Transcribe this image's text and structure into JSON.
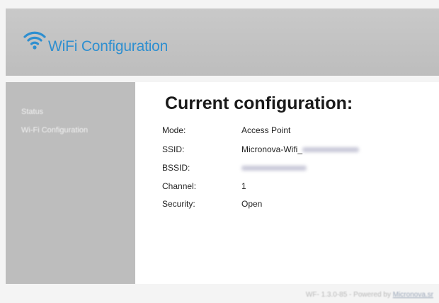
{
  "header": {
    "title": "WiFi Configuration",
    "logo_icon": "wifi-icon",
    "accent_color": "#2e8fd0"
  },
  "sidebar": {
    "items": [
      {
        "label": "Status"
      },
      {
        "label": "Wi-Fi Configuration"
      }
    ]
  },
  "main": {
    "title": "Current configuration:",
    "fields": [
      {
        "label": "Mode:",
        "value": "Access Point"
      },
      {
        "label": "SSID:",
        "value": "Micronova-Wifi_"
      },
      {
        "label": "BSSID:",
        "value": ""
      },
      {
        "label": "Channel:",
        "value": "1"
      },
      {
        "label": "Security:",
        "value": "Open"
      }
    ]
  },
  "footer": {
    "version_text": "WF- 1.3.0-85 - Powered by",
    "link_text": "Micronova.sr"
  }
}
